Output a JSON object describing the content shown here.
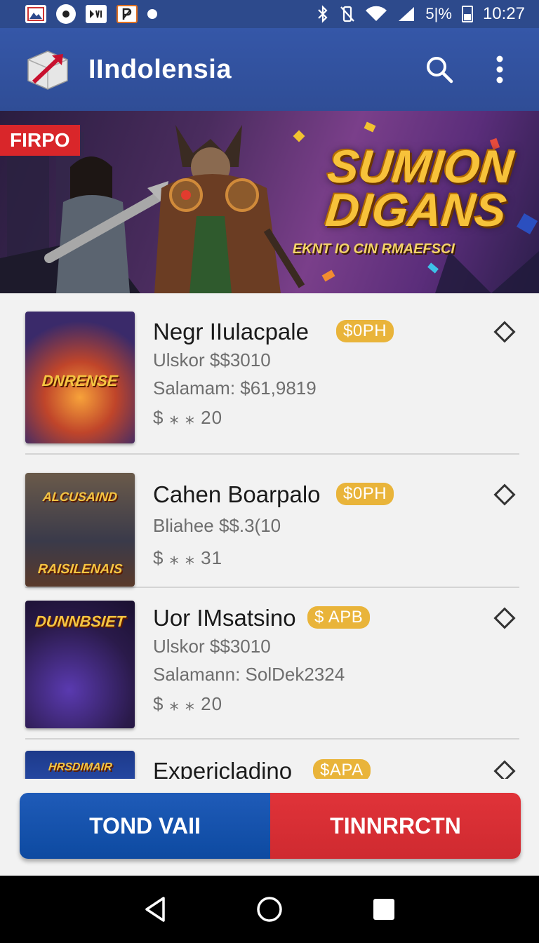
{
  "status_bar": {
    "left_icons": [
      "gallery-icon",
      "record-icon",
      "media-icon",
      "parking-icon",
      "notification-dot-icon"
    ],
    "battery": "5|%",
    "time": "10:27"
  },
  "app_bar": {
    "title": "IIndolensia",
    "search_icon": "search-icon",
    "menu_icon": "more-vert-icon"
  },
  "banner": {
    "tag": "FIRPO",
    "title_line1": "SUMION",
    "title_line2": "DIGANS",
    "subtitle": "EKNT IO CIN RMAEFSCI"
  },
  "items": [
    {
      "thumb_text": "DNRENSE",
      "title": "Negr IIulacpale",
      "badge": "$0PH",
      "line1": "Ulskor $$3010",
      "line2": "Salamam: $61,9819",
      "stars": "$ ⁎ ⁎ 20"
    },
    {
      "thumb_text_top": "ALCUSAIND",
      "thumb_text": "RAISILENAIS",
      "title": "Cahen Boarpalo",
      "badge": "$0PH",
      "line1": "Bliahee $$.3(10",
      "stars": "$ ⁎ ⁎ 31"
    },
    {
      "thumb_text": "DUNNBSIET",
      "title": "Uor IMsatsino",
      "badge": "$ APB",
      "line1": "Ulskor $$3010",
      "line2": "Salamann: SolDek2324",
      "stars": "$ ⁎ ⁎ 20"
    },
    {
      "thumb_text": "HRSDIMAIR",
      "title": "Expericladino",
      "badge": "$APA"
    }
  ],
  "buttons": {
    "left": "TOND VAII",
    "right": "TINNRRCTN"
  },
  "nav": {
    "back_icon": "back-icon",
    "home_icon": "home-icon",
    "recents_icon": "recents-icon"
  },
  "colors": {
    "app_bar": "#3055a3",
    "badge": "#e9b43a",
    "button_blue": "#1552ad",
    "button_red": "#d92d33"
  }
}
